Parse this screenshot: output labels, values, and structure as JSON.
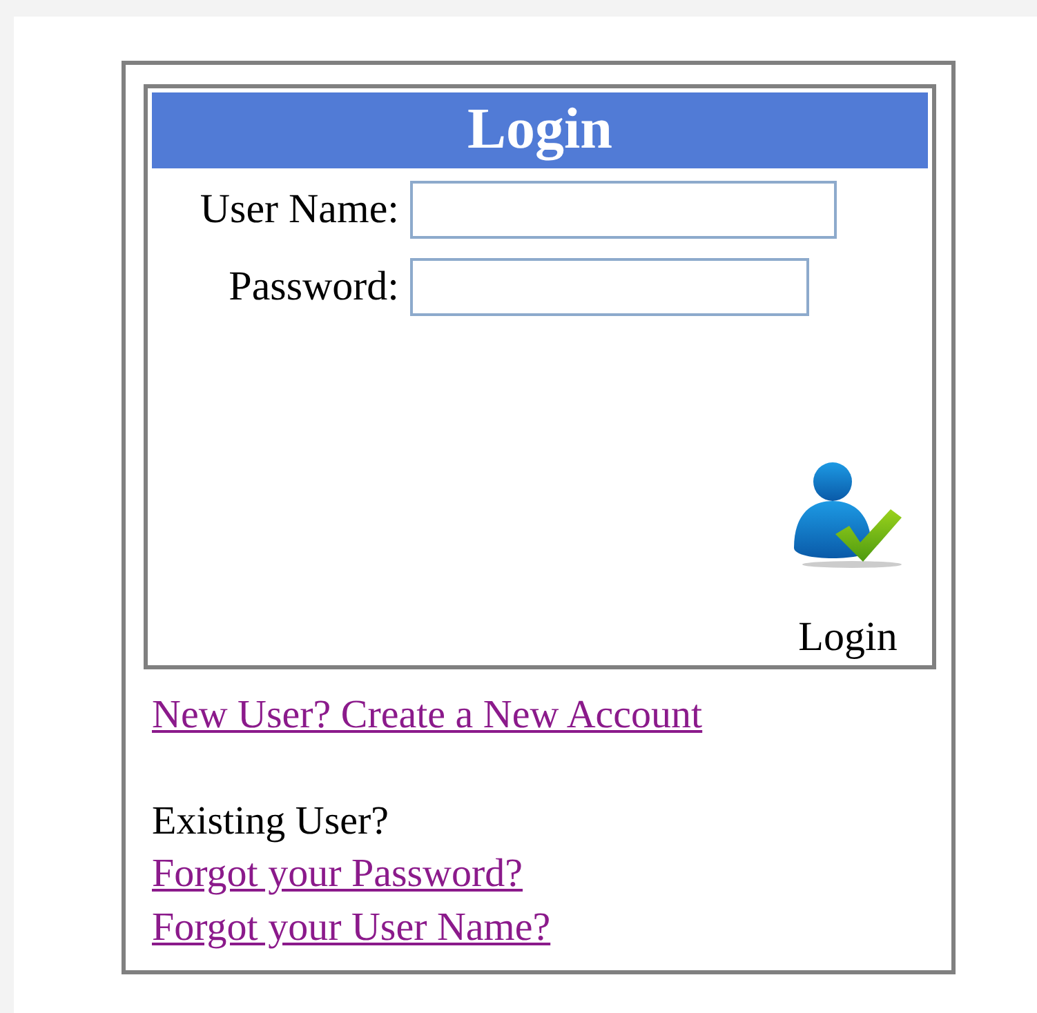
{
  "login_box": {
    "title": "Login",
    "fields": [
      {
        "label": "User Name:",
        "kind": "text"
      },
      {
        "label": "Password:",
        "kind": "password"
      }
    ],
    "submit_button": {
      "label": "Login"
    }
  },
  "links": [
    {
      "kind": "link",
      "text": "New User? Create a New Account"
    },
    {
      "kind": "gap"
    },
    {
      "kind": "text",
      "text": "Existing User?"
    },
    {
      "kind": "link",
      "text": "Forgot your Password?"
    },
    {
      "kind": "link",
      "text": "Forgot your User Name?"
    }
  ]
}
